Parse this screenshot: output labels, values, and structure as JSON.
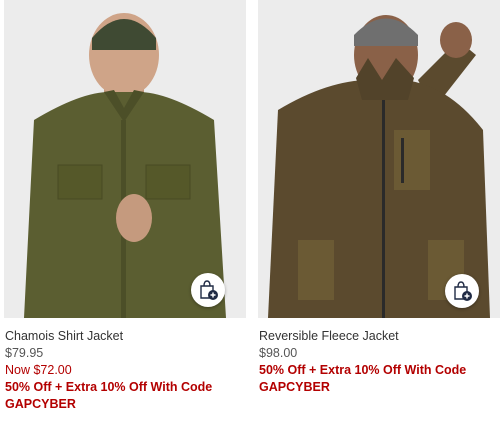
{
  "products": [
    {
      "name": "Chamois Shirt Jacket",
      "price": "$79.95",
      "sale_price": "Now $72.00",
      "promo": "50% Off + Extra 10% Off With Code GAPCYBER",
      "quick_add_icon": "shopping-bag-plus-icon",
      "colors": {
        "garment": "#5b5e31",
        "beanie": "#3f4a33"
      }
    },
    {
      "name": "Reversible Fleece Jacket",
      "price": "$98.00",
      "promo": "50% Off + Extra 10% Off With Code GAPCYBER",
      "quick_add_icon": "shopping-bag-plus-icon",
      "colors": {
        "garment": "#5b4a2e",
        "beanie": "#6f6f6f"
      }
    }
  ],
  "colors": {
    "sale_red": "#b30000",
    "bag_icon_navy": "#1f2a44"
  }
}
